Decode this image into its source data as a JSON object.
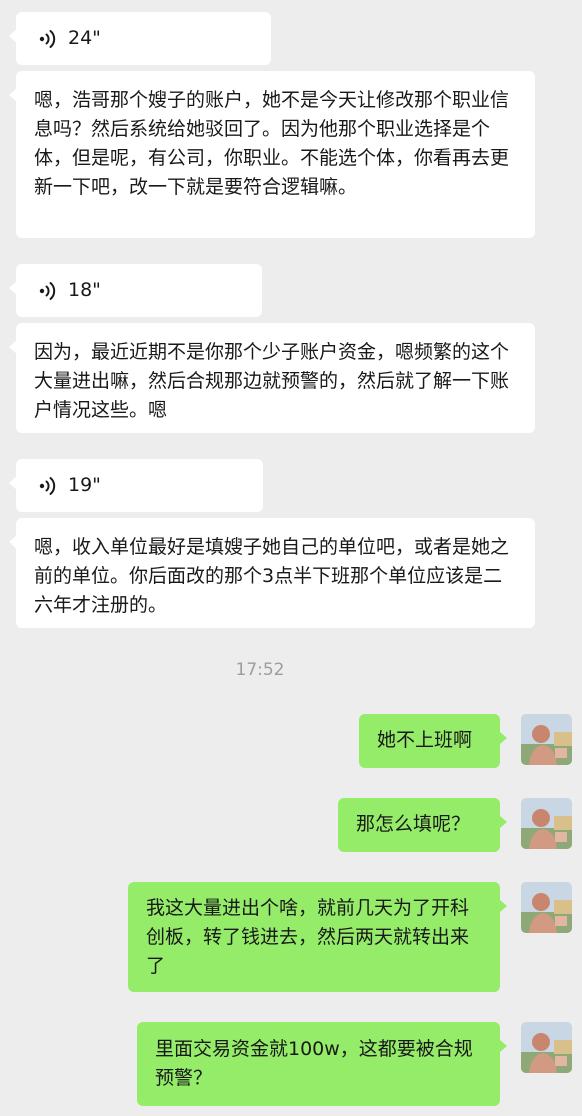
{
  "messages": [
    {
      "side": "left",
      "type": "voice",
      "duration": "24\""
    },
    {
      "side": "left",
      "type": "text",
      "text": "嗯，浩哥那个嫂子的账户，她不是今天让修改那个职业信息吗？然后系统给她驳回了。因为他那个职业选择是个体，但是呢，有公司，你职业。不能选个体，你看再去更新一下吧，改一下就是要符合逻辑嘛。"
    },
    {
      "side": "left",
      "type": "voice",
      "duration": "18\""
    },
    {
      "side": "left",
      "type": "text",
      "text": "因为，最近近期不是你那个少子账户资金，嗯频繁的这个大量进出嘛，然后合规那边就预警的，然后就了解一下账户情况这些。嗯"
    },
    {
      "side": "left",
      "type": "voice",
      "duration": "19\""
    },
    {
      "side": "left",
      "type": "text",
      "text": "嗯，收入单位最好是填嫂子她自己的单位吧，或者是她之前的单位。你后面改的那个3点半下班那个单位应该是二六年才注册的。"
    },
    {
      "side": "right",
      "type": "text",
      "text": "她不上班啊"
    },
    {
      "side": "right",
      "type": "text",
      "text": "那怎么填呢？"
    },
    {
      "side": "right",
      "type": "text",
      "text": "我这大量进出个啥，就前几天为了开科创板，转了钱进去，然后两天就转出来了"
    },
    {
      "side": "right",
      "type": "text",
      "text": "里面交易资金就100w，这都要被合规预警？"
    }
  ],
  "timestamp": "17:52",
  "colors": {
    "background": "#ededed",
    "bubble_incoming": "#ffffff",
    "bubble_outgoing": "#95ec69",
    "timestamp": "#9d9d9d"
  },
  "icons": {
    "voice": "voice-wave-icon",
    "avatar": "user-avatar"
  }
}
